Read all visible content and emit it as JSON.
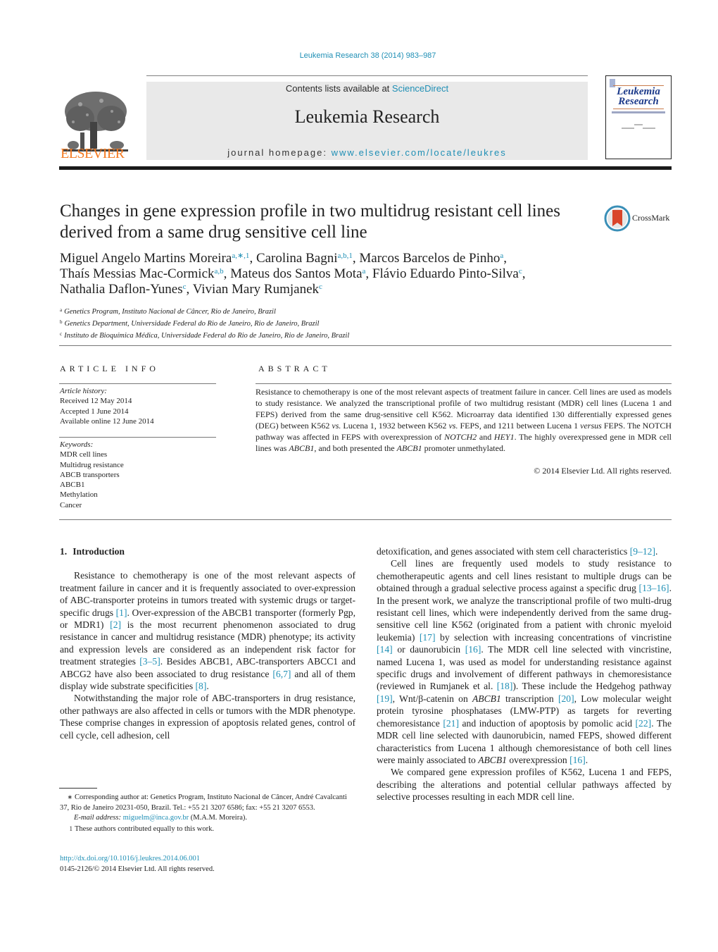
{
  "header": {
    "citation": "Leukemia Research 38 (2014) 983–987",
    "contents_prefix": "Contents lists available at ",
    "contents_link": "ScienceDirect",
    "journal_title": "Leukemia Research",
    "homepage_prefix": "journal homepage: ",
    "homepage_link": "www.elsevier.com/locate/leukres",
    "publisher_logo": "ELSEVIER",
    "cover_title_line1": "Leukemia",
    "cover_title_line2": "Research"
  },
  "article": {
    "title": "Changes in gene expression profile in two multidrug resistant cell lines derived from a same drug sensitive cell line",
    "crossmark_label": "CrossMark",
    "authors": [
      {
        "name": "Miguel Angelo Martins Moreira",
        "sup": "a,∗,1",
        "sep": ", "
      },
      {
        "name": "Carolina Bagni",
        "sup": "a,b,1",
        "sep": ", "
      },
      {
        "name": "Marcos Barcelos de Pinho",
        "sup": "a",
        "sep": ","
      },
      {
        "name": "Thaís Messias Mac-Cormick",
        "sup": "a,b",
        "sep": ", "
      },
      {
        "name": "Mateus dos Santos Mota",
        "sup": "a",
        "sep": ", "
      },
      {
        "name": "Flávio Eduardo Pinto-Silva",
        "sup": "c",
        "sep": ","
      },
      {
        "name": "Nathalia Daflon-Yunes",
        "sup": "c",
        "sep": ", "
      },
      {
        "name": "Vivian Mary Rumjanek",
        "sup": "c",
        "sep": ""
      }
    ],
    "affiliations": [
      {
        "mark": "a",
        "text": "Genetics Program, Instituto Nacional de Câncer, Rio de Janeiro, Brazil"
      },
      {
        "mark": "b",
        "text": "Genetics Department, Universidade Federal do Rio de Janeiro, Rio de Janeiro, Brazil"
      },
      {
        "mark": "c",
        "text": "Instituto de Bioquímica Médica, Universidade Federal do Rio de Janeiro, Rio de Janeiro, Brazil"
      }
    ]
  },
  "article_info": {
    "label": "ARTICLE INFO",
    "history_heading": "Article history:",
    "history": [
      "Received 12 May 2014",
      "Accepted 1 June 2014",
      "Available online 12 June 2014"
    ],
    "keywords_heading": "Keywords:",
    "keywords": [
      "MDR cell lines",
      "Multidrug resistance",
      "ABCB transporters",
      "ABCB1",
      "Methylation",
      "Cancer"
    ]
  },
  "abstract": {
    "label": "ABSTRACT",
    "segments": [
      {
        "t": "Resistance to chemotherapy is one of the most relevant aspects of treatment failure in cancer. Cell lines are used as models to study resistance. We analyzed the transcriptional profile of two multidrug resistant (MDR) cell lines (Lucena 1 and FEPS) derived from the same drug-sensitive cell K562. Microarray data identified 130 differentially expressed genes (DEG) between K562 "
      },
      {
        "t": "vs.",
        "i": true
      },
      {
        "t": " Lucena 1, 1932 between K562 "
      },
      {
        "t": "vs.",
        "i": true
      },
      {
        "t": " FEPS, and 1211 between Lucena 1 "
      },
      {
        "t": "versus",
        "i": true
      },
      {
        "t": " FEPS. The NOTCH pathway was affected in FEPS with overexpression of "
      },
      {
        "t": "NOTCH2",
        "i": true
      },
      {
        "t": " and "
      },
      {
        "t": "HEY1",
        "i": true
      },
      {
        "t": ". The highly overexpressed gene in MDR cell lines was "
      },
      {
        "t": "ABCB1",
        "i": true
      },
      {
        "t": ", and both presented the "
      },
      {
        "t": "ABCB1",
        "i": true
      },
      {
        "t": " promoter unmethylated."
      }
    ],
    "copyright": "© 2014 Elsevier Ltd. All rights reserved."
  },
  "body": {
    "section_number": "1.",
    "section_title": "Introduction",
    "left_paragraphs": [
      [
        {
          "t": "Resistance to chemotherapy is one of the most relevant aspects of treatment failure in cancer and it is frequently associated to over-expression of ABC-transporter proteins in tumors treated with systemic drugs or target-specific drugs "
        },
        {
          "t": "[1]",
          "ref": true
        },
        {
          "t": ". Over-expression of the ABCB1 transporter (formerly Pgp, or MDR1) "
        },
        {
          "t": "[2]",
          "ref": true
        },
        {
          "t": " is the most recurrent phenomenon associated to drug resistance in cancer and multidrug resistance (MDR) phenotype; its activity and expression levels are considered as an independent risk factor for treatment strategies "
        },
        {
          "t": "[3–5]",
          "ref": true
        },
        {
          "t": ". Besides ABCB1, ABC-transporters ABCC1 and ABCG2 have also been associated to drug resistance "
        },
        {
          "t": "[6,7]",
          "ref": true
        },
        {
          "t": " and all of them display wide substrate specificities "
        },
        {
          "t": "[8]",
          "ref": true
        },
        {
          "t": "."
        }
      ],
      [
        {
          "t": "Notwithstanding the major role of ABC-transporters in drug resistance, other pathways are also affected in cells or tumors with the MDR phenotype. These comprise changes in expression of apoptosis related genes, control of cell cycle, cell adhesion, cell"
        }
      ]
    ],
    "right_paragraphs": [
      [
        {
          "t": "detoxification, and genes associated with stem cell characteristics "
        },
        {
          "t": "[9–12]",
          "ref": true
        },
        {
          "t": "."
        }
      ],
      [
        {
          "t": "Cell lines are frequently used models to study resistance to chemotherapeutic agents and cell lines resistant to multiple drugs can be obtained through a gradual selective process against a specific drug "
        },
        {
          "t": "[13–16]",
          "ref": true
        },
        {
          "t": ". In the present work, we analyze the transcriptional profile of two multi-drug resistant cell lines, which were independently derived from the same drug-sensitive cell line K562 (originated from a patient with chronic myeloid leukemia) "
        },
        {
          "t": "[17]",
          "ref": true
        },
        {
          "t": " by selection with increasing concentrations of vincristine "
        },
        {
          "t": "[14]",
          "ref": true
        },
        {
          "t": " or daunorubicin "
        },
        {
          "t": "[16]",
          "ref": true
        },
        {
          "t": ". The MDR cell line selected with vincristine, named Lucena 1, was used as model for understanding resistance against specific drugs and involvement of different pathways in chemoresistance (reviewed in Rumjanek et al. "
        },
        {
          "t": "[18]",
          "ref": true
        },
        {
          "t": "). These include the Hedgehog pathway "
        },
        {
          "t": "[19]",
          "ref": true
        },
        {
          "t": ", Wnt/β-catenin on "
        },
        {
          "t": "ABCB1",
          "i": true
        },
        {
          "t": " transcription "
        },
        {
          "t": "[20]",
          "ref": true
        },
        {
          "t": ", Low molecular weight protein tyrosine phosphatases (LMW-PTP) as targets for reverting chemoresistance "
        },
        {
          "t": "[21]",
          "ref": true
        },
        {
          "t": " and induction of apoptosis by pomolic acid "
        },
        {
          "t": "[22]",
          "ref": true
        },
        {
          "t": ". The MDR cell line selected with daunorubicin, named FEPS, showed different characteristics from Lucena 1 although chemoresistance of both cell lines were mainly associated to "
        },
        {
          "t": "ABCB1",
          "i": true
        },
        {
          "t": " overexpression "
        },
        {
          "t": "[16]",
          "ref": true
        },
        {
          "t": "."
        }
      ],
      [
        {
          "t": "We compared gene expression profiles of K562, Lucena 1 and FEPS, describing the alterations and potential cellular pathways affected by selective processes resulting in each MDR cell line."
        }
      ]
    ]
  },
  "footnotes": {
    "corresponding_mark": "∗",
    "corresponding": "Corresponding author at: Genetics Program, Instituto Nacional de Câncer, André Cavalcanti 37, Rio de Janeiro 20231-050, Brazil. Tel.: +55 21 3207 6586; fax: +55 21 3207 6553.",
    "email_label": "E-mail address:",
    "email": "miguelm@inca.gov.br",
    "email_suffix": " (M.A.M. Moreira).",
    "equal_mark": "1",
    "equal": "These authors contributed equally to this work.",
    "doi": "http://dx.doi.org/10.1016/j.leukres.2014.06.001",
    "issn": "0145-2126/© 2014 Elsevier Ltd. All rights reserved."
  },
  "colors": {
    "link": "#1f8fb5",
    "elsevier_orange": "#f47920",
    "banner_gray": "#e9e9e9",
    "crossmark_red": "#d9452b"
  }
}
